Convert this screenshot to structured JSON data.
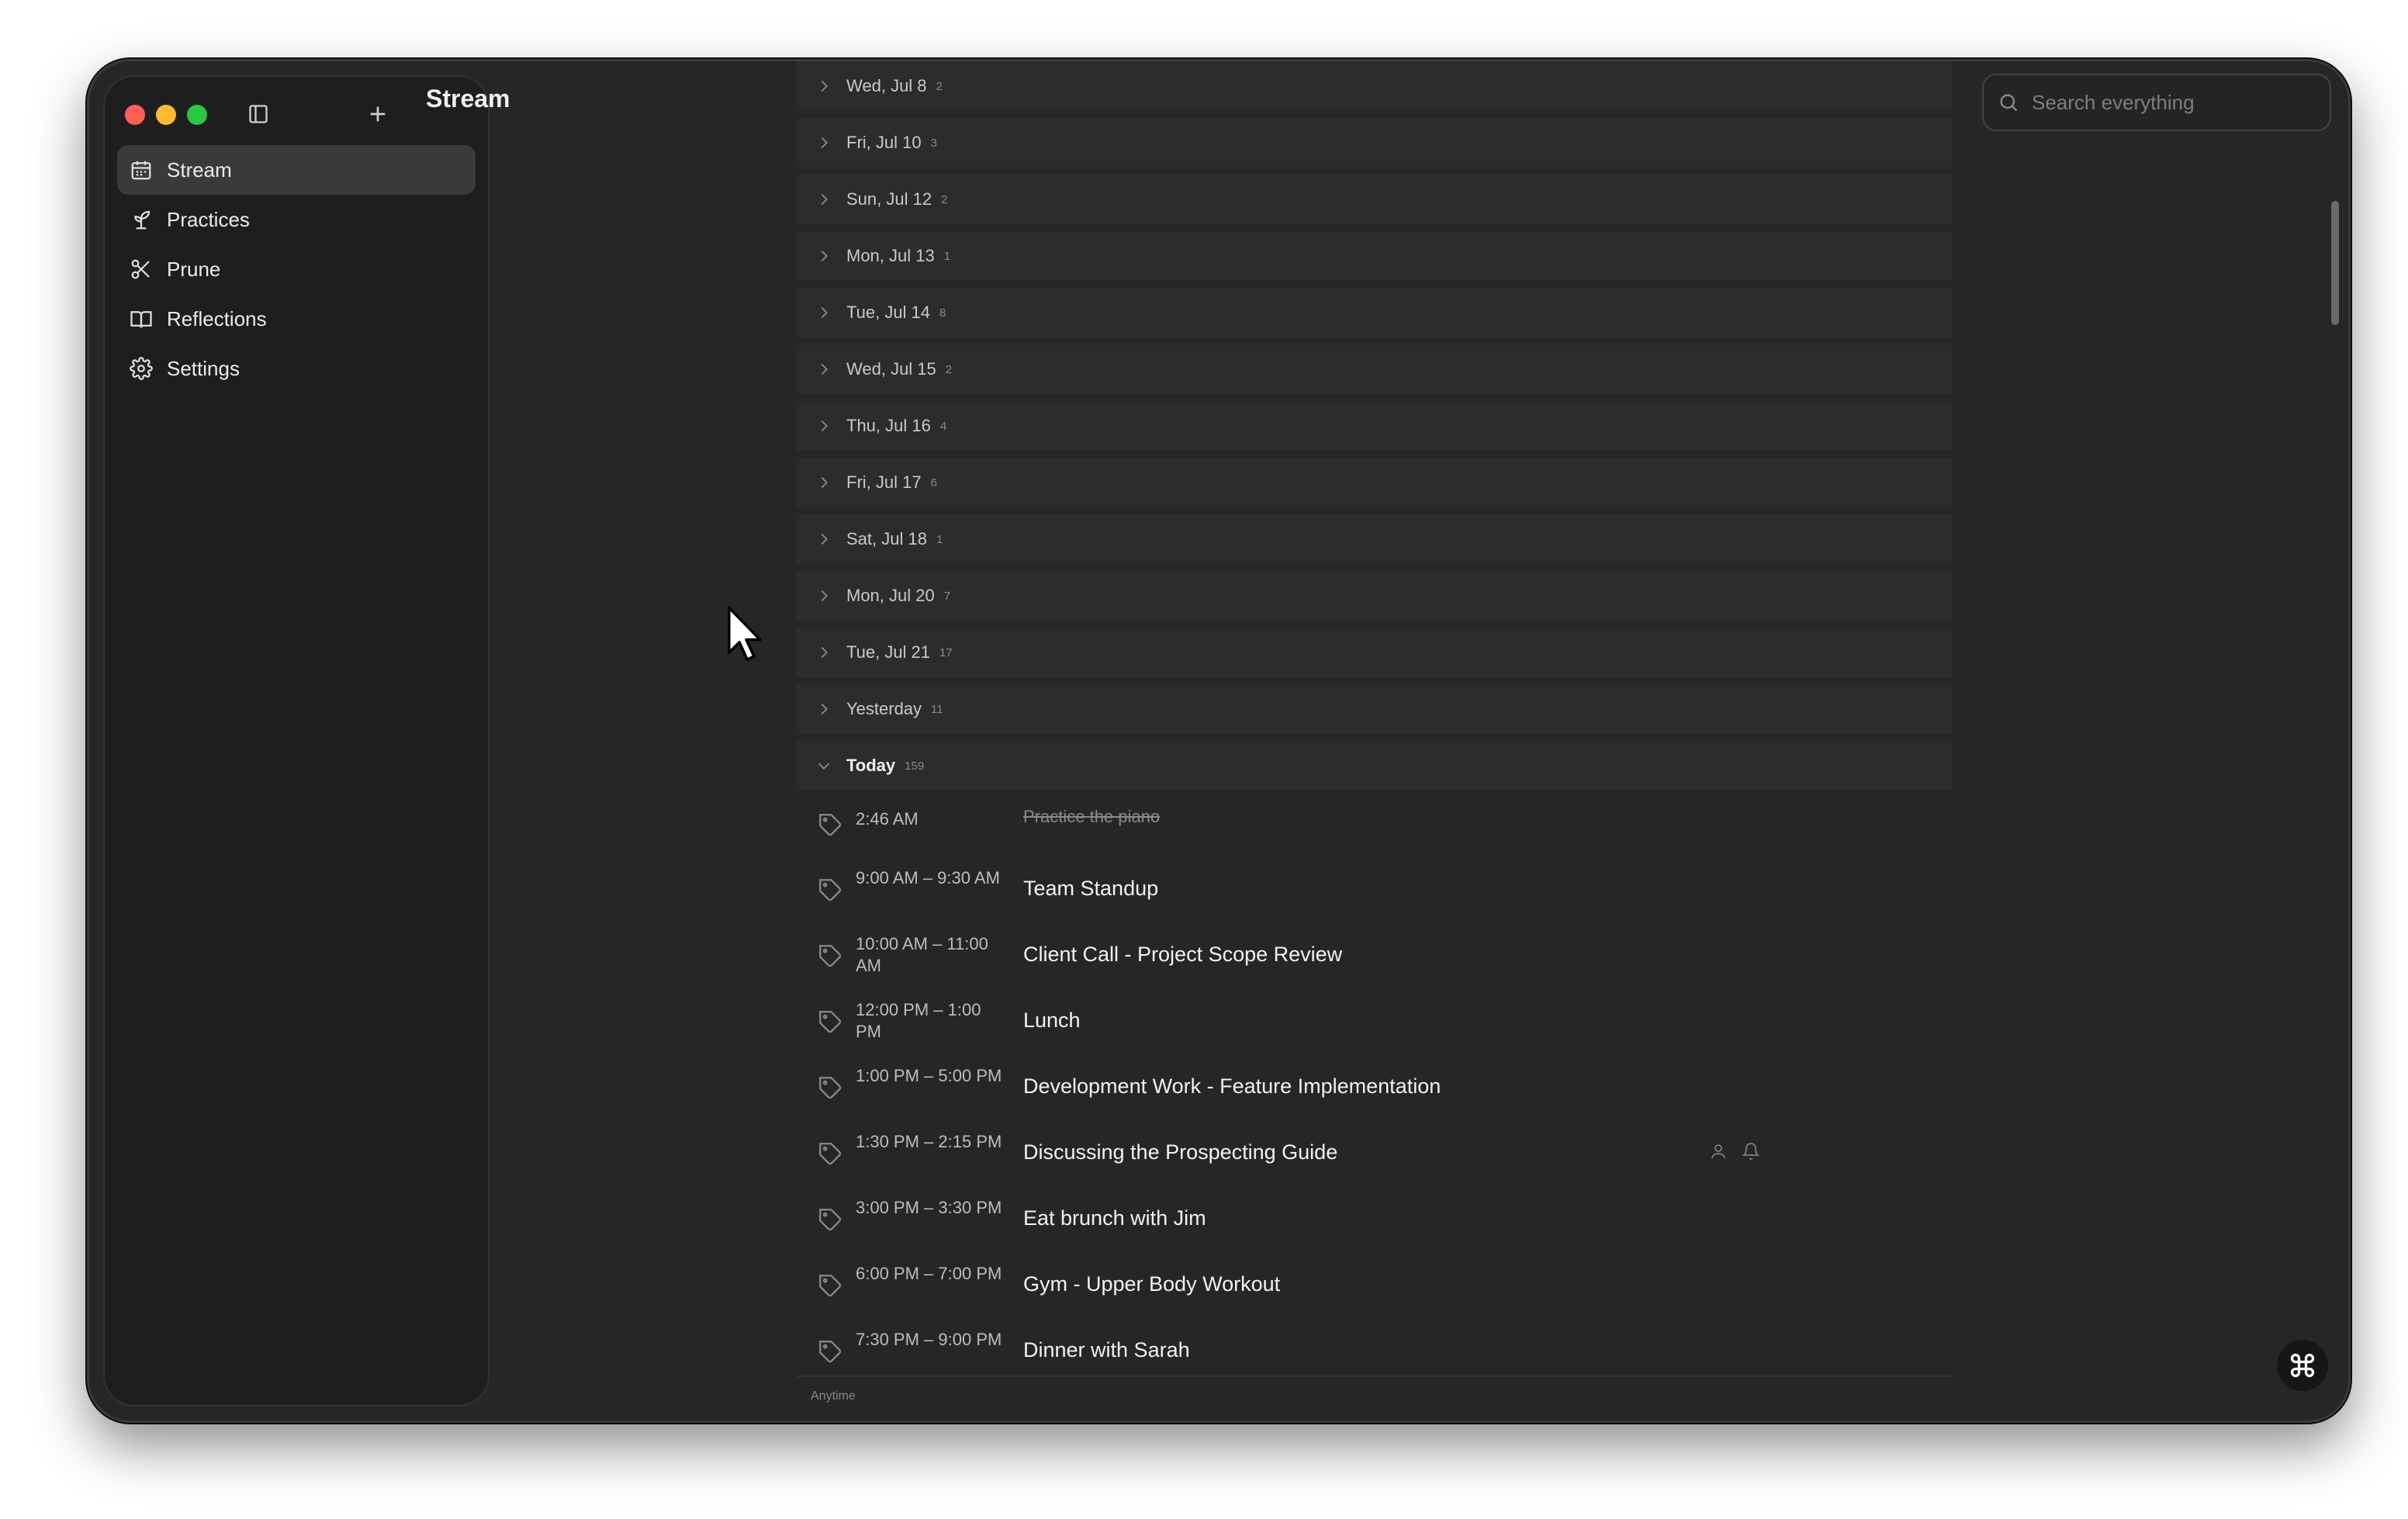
{
  "app": {
    "title": "Stream"
  },
  "sidebar": {
    "items": [
      {
        "label": "Stream",
        "icon": "calendar-icon",
        "active": true
      },
      {
        "label": "Practices",
        "icon": "plant-icon"
      },
      {
        "label": "Prune",
        "icon": "scissors-icon"
      },
      {
        "label": "Reflections",
        "icon": "book-icon"
      },
      {
        "label": "Settings",
        "icon": "gear-icon"
      }
    ]
  },
  "days": [
    {
      "label": "Wed, Jul 8",
      "count": "2"
    },
    {
      "label": "Fri, Jul 10",
      "count": "3"
    },
    {
      "label": "Sun, Jul 12",
      "count": "2"
    },
    {
      "label": "Mon, Jul 13",
      "count": "1"
    },
    {
      "label": "Tue, Jul 14",
      "count": "8"
    },
    {
      "label": "Wed, Jul 15",
      "count": "2"
    },
    {
      "label": "Thu, Jul 16",
      "count": "4"
    },
    {
      "label": "Fri, Jul 17",
      "count": "6"
    },
    {
      "label": "Sat, Jul 18",
      "count": "1"
    },
    {
      "label": "Mon, Jul 20",
      "count": "7"
    },
    {
      "label": "Tue, Jul 21",
      "count": "17"
    },
    {
      "label": "Yesterday",
      "count": "11"
    },
    {
      "label": "Today",
      "count": "159"
    }
  ],
  "events": [
    {
      "time": "2:46 AM",
      "title": "Practice the piano",
      "done": true
    },
    {
      "time": "9:00 AM – 9:30 AM",
      "title": "Team Standup"
    },
    {
      "time": "10:00 AM – 11:00 AM",
      "title": "Client Call - Project Scope Review"
    },
    {
      "time": "12:00 PM – 1:00 PM",
      "title": "Lunch"
    },
    {
      "time": "1:00 PM – 5:00 PM",
      "title": "Development Work - Feature Implementation"
    },
    {
      "time": "1:30 PM – 2:15 PM",
      "title": "Discussing the Prospecting Guide",
      "icons": [
        "person-icon",
        "bell-icon"
      ]
    },
    {
      "time": "3:00 PM – 3:30 PM",
      "title": "Eat brunch with Jim"
    },
    {
      "time": "6:00 PM – 7:00 PM",
      "title": "Gym - Upper Body Workout"
    },
    {
      "time": "7:30 PM – 9:00 PM",
      "title": "Dinner with Sarah"
    }
  ],
  "anytime": {
    "label": "Anytime"
  },
  "search": {
    "placeholder": "Search everything"
  },
  "colors": {
    "background": "#262626",
    "sidebar": "#1e1e1e",
    "row": "#2c2c2c",
    "active_nav": "#3a3a3a",
    "close": "#fe5f57",
    "minimize": "#febc2e",
    "zoom": "#28c840"
  }
}
